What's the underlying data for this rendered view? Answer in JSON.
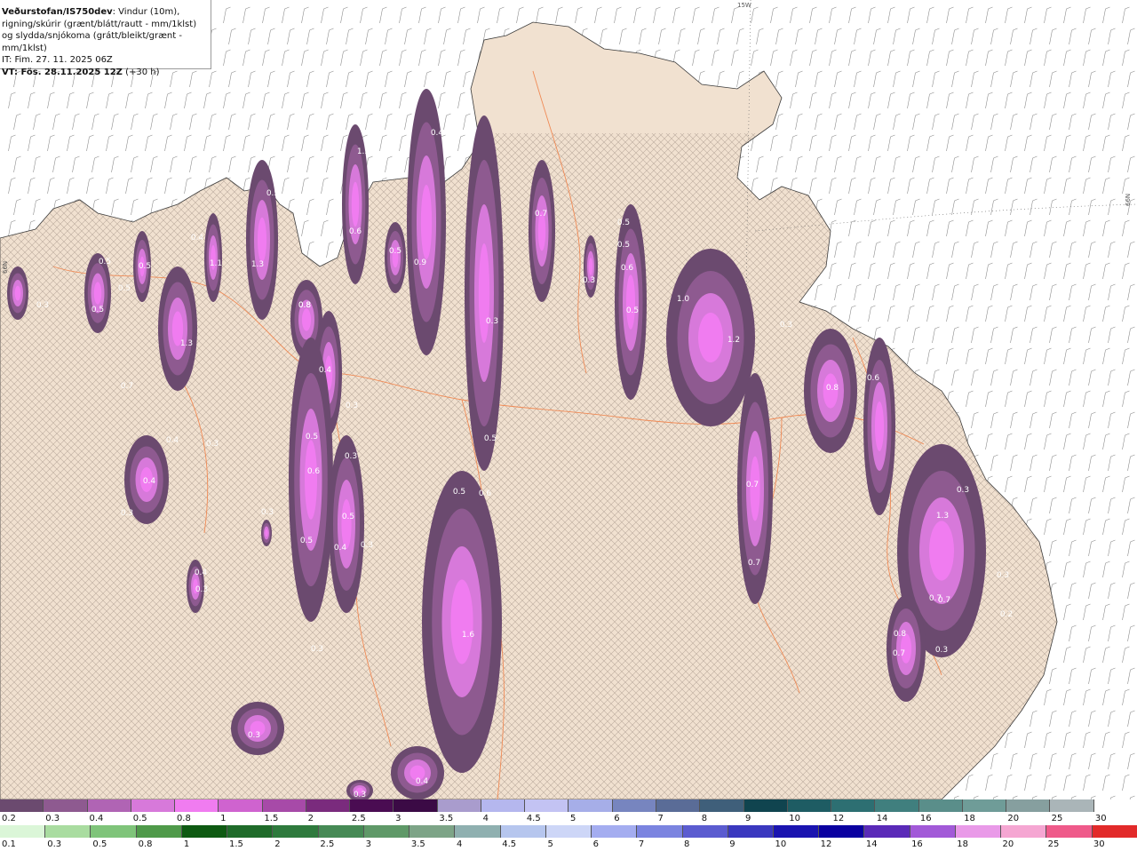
{
  "header": {
    "title": "Veðurstofan/IS750dev",
    "description": ": Vindur (10m), rigning/skúrir (grænt/blátt/rautt - mm/1klst) og slydda/snjókoma (grátt/bleikt/grænt - mm/1klst)",
    "init_time": "IT: Fim. 27. 11. 2025 06Z",
    "valid_time_label": "VT: Fös. 28.11.2025 12Z",
    "lead_time": "(+30 h)"
  },
  "grid_labels": {
    "top": "15W",
    "right": "66N",
    "left": "66N"
  },
  "map_colors": {
    "sea": "#ffffff",
    "land": "#f1e1d0",
    "roads": "#f08a55",
    "coast": "#3a3a3a",
    "wind_barb": "#7a7a7a"
  },
  "precip_values": [
    "0.3",
    "0.5",
    "0.5",
    "0.5",
    "0.5",
    "0.4",
    "1.1",
    "1.3",
    "0.8",
    "1.3",
    "0.7",
    "0.4",
    "0.3",
    "0.4",
    "0.3",
    "0.4",
    "0.3",
    "0.3",
    "0.3",
    "0.5",
    "0.6",
    "0.5",
    "0.5",
    "0.3",
    "0.4",
    "0.9",
    "0.5",
    "0.4",
    "1.5",
    "0.3",
    "0.5",
    "0.8",
    "0.6",
    "1.0",
    "0.5",
    "0.5",
    "0.7",
    "0.5",
    "0.6",
    "1.6",
    "0.4",
    "0.3",
    "0.3",
    "0.3",
    "0.4",
    "0.3",
    "0.5",
    "0.6",
    "0.5",
    "0.3",
    "1.2",
    "0.3",
    "0.7",
    "0.8",
    "0.6",
    "0.7",
    "0.3",
    "0.7",
    "1.3",
    "0.3",
    "0.7",
    "0.2",
    "0.8",
    "0.7",
    "0.3"
  ],
  "legend_snow": {
    "labels": [
      "0.2",
      "0.3",
      "0.4",
      "0.5",
      "0.8",
      "1",
      "1.5",
      "2",
      "2.5",
      "3",
      "3.5",
      "4",
      "4.5",
      "5",
      "6",
      "7",
      "8",
      "9",
      "10",
      "12",
      "14",
      "16",
      "18",
      "20",
      "25",
      "30"
    ],
    "colors": [
      "#6b4a6f",
      "#8e5a90",
      "#b064b4",
      "#d779da",
      "#f07cf0",
      "#cf63cf",
      "#a74aa8",
      "#7a2b7d",
      "#4a0c52",
      "#3b0a45",
      "#a99ccd",
      "#b5b7ee",
      "#c3c3f3",
      "#a6aee8",
      "#7785bf",
      "#5a6c97",
      "#3f5f7a",
      "#10444f",
      "#1e5c63",
      "#2d6f72",
      "#407f7e",
      "#5a8e8a",
      "#6f9c98",
      "#869f9f",
      "#aab5b8",
      "#ffffff"
    ]
  },
  "legend_rain": {
    "labels": [
      "0.1",
      "0.3",
      "0.5",
      "0.8",
      "1",
      "1.5",
      "2",
      "2.5",
      "3",
      "3.5",
      "4",
      "4.5",
      "5",
      "6",
      "7",
      "8",
      "9",
      "10",
      "12",
      "14",
      "16",
      "18",
      "20",
      "25",
      "30"
    ],
    "colors": [
      "#dbf6d8",
      "#a9dca0",
      "#7fc47a",
      "#4f9a4a",
      "#0e5a12",
      "#1f6b2a",
      "#2e7a3d",
      "#468a55",
      "#5f9968",
      "#7da487",
      "#8fb0b0",
      "#b6c6ee",
      "#cdd6f7",
      "#a4adf0",
      "#7b84e0",
      "#5b5cd0",
      "#3a38bf",
      "#1a14b0",
      "#0a00a0",
      "#5a2ab8",
      "#a25ad8",
      "#e99ae8",
      "#f5a6d2",
      "#ef5a8a",
      "#e22a2a"
    ]
  }
}
